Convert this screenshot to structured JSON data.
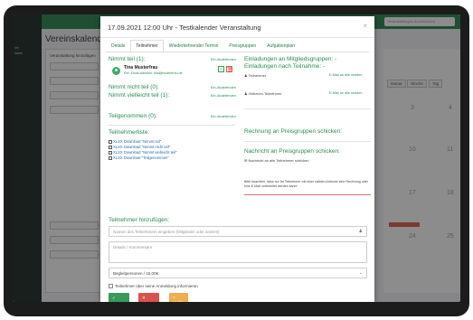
{
  "modal": {
    "title": "17.09.2021 12:00 Uhr - Testkalender Veranstaltung",
    "close": "×",
    "tabs": [
      "Details",
      "Teilnehmer",
      "Wiederkehrender Termin",
      "Preisgruppen",
      "Aufgabenplan"
    ],
    "active_tab": "Teilnehmer"
  },
  "left": {
    "nimmt_teil": "Nimmt teil (1):",
    "alle_ausblenden": "Ein-/Ausblenden",
    "person_name": "Tina Musterfrau",
    "person_email": "Ref. Email-Adresse: tina@musterfrau.de",
    "nimmt_nicht_teil": "Nimmt nicht teil (0):",
    "nimmt_vielleicht": "Nimmt vielleicht teil (1):",
    "teilgenommen": "Teilgenommen (0):",
    "teilnehmerliste": "Teilnehmerliste:",
    "downloads": [
      "XLSX Download \"Nimmt teil\"",
      "XLSX Download \"Nimmt nicht teil\"",
      "XLSX Download \"Nimmt vielleicht teil\"",
      "XLSX Download \"Teilgenommen\""
    ]
  },
  "right": {
    "einladungen_gruppen": "Einladungen an Mitgliedsgruppen: -",
    "einladungen_teilnehmer": "Einladungen nach Teilnahme: -",
    "teilnehmer_label": "Teilnehmer",
    "vielleicht_label": "Vielleicht-Teilnehmer",
    "email_senden": "E-Mail an alle senden",
    "rechnung": "Rechnung an Preisgruppen schicken:",
    "nachricht": "Nachricht an Preisgruppen schicken:",
    "nachricht_link": "Nachricht an alle Teilnehmer schicken",
    "hinweis": "Bitte beachten, dass nur für Teilnehmer mit einer validen Adresse eine Rechnung oder eine E-Mail vorbereitet werden kann!"
  },
  "bottom": {
    "hinzufuegen": "Teilnehmer hinzufügen:",
    "name_placeholder": "Namen des Teilnehmers eingeben (Mitglieder oder andere)",
    "details_placeholder": "Details / Kommentare",
    "begleit": "Begleitpersonen / 15,00€",
    "informieren": "Teilnehmer über seine Anmeldung informieren",
    "btn_zusage": "✓ Zusage",
    "btn_absage": "✕ Absage",
    "btn_unklar": "? Unklar"
  },
  "background": {
    "page_title": "Vereinskalender",
    "search_placeholder": "Veranstaltungen durchsuchen",
    "panel_heading": "Veranstaltung hinzufügen",
    "view_buttons": [
      "Monat",
      "Woche",
      "Tag"
    ],
    "cal_numbers": [
      "3",
      "4",
      "10",
      "11",
      "17",
      "18",
      "24",
      "25"
    ]
  },
  "colors": {
    "accent": "#2a8a52",
    "danger": "#d9534f",
    "warning": "#f0ad4e",
    "sidebar": "#2d3a33"
  }
}
